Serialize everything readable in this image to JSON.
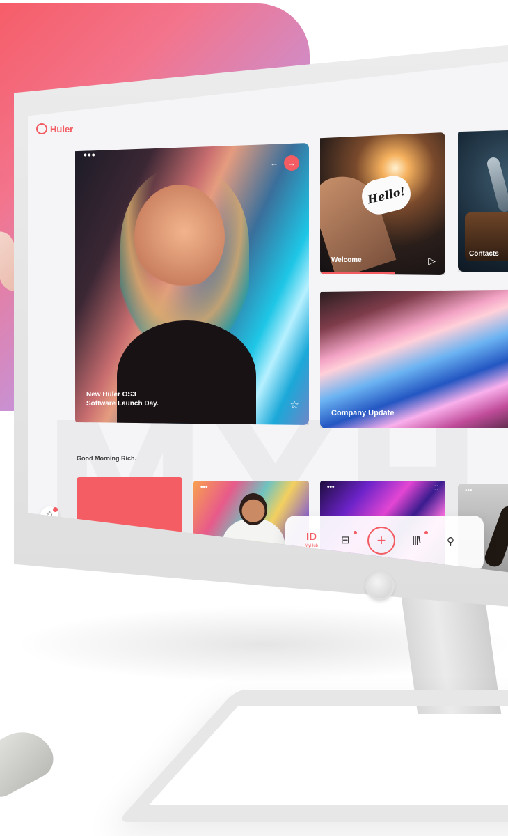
{
  "app": {
    "logo_text": "Huler"
  },
  "hero": {
    "caption_line1": "New Huler OS3",
    "caption_line2": "Software Launch Day."
  },
  "welcome": {
    "label": "Welcome",
    "sticker_text": "Hello!",
    "progress": 0.6
  },
  "contacts": {
    "label": "Contacts"
  },
  "company": {
    "label": "Company Update"
  },
  "greeting": "Good Morning Rich.",
  "dock": {
    "myhub_label": "MyHub"
  },
  "icons": {
    "more": "more-dots-icon",
    "back": "arrow-left-icon",
    "next": "arrow-right-icon",
    "star": "star-icon",
    "play": "play-icon",
    "bell": "bell-icon",
    "add": "plus-icon",
    "widgets": "widgets-icon",
    "library": "library-icon",
    "search": "search-icon"
  },
  "colors": {
    "accent": "#f25c62",
    "screen_bg": "#f5f5f7"
  }
}
